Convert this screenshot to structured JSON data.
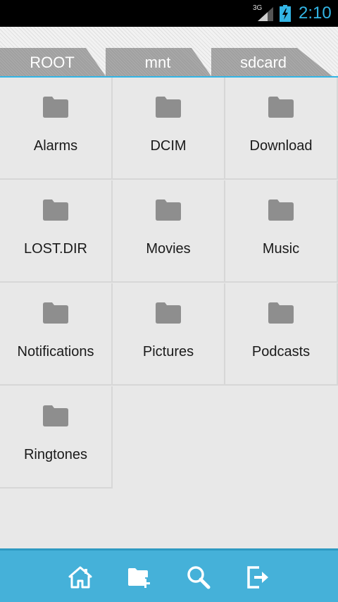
{
  "status_bar": {
    "network": "3G",
    "time": "2:10",
    "colors": {
      "background": "#000000",
      "clock": "#33b5e5"
    },
    "icons": [
      "signal-icon",
      "battery-charging-icon"
    ]
  },
  "breadcrumbs": [
    {
      "label": "ROOT"
    },
    {
      "label": "mnt"
    },
    {
      "label": "sdcard"
    }
  ],
  "folders": [
    {
      "name": "Alarms"
    },
    {
      "name": "DCIM"
    },
    {
      "name": "Download"
    },
    {
      "name": "LOST.DIR"
    },
    {
      "name": "Movies"
    },
    {
      "name": "Music"
    },
    {
      "name": "Notifications"
    },
    {
      "name": "Pictures"
    },
    {
      "name": "Podcasts"
    },
    {
      "name": "Ringtones"
    }
  ],
  "toolbar": {
    "items": [
      {
        "icon": "home-icon"
      },
      {
        "icon": "new-folder-icon"
      },
      {
        "icon": "search-icon"
      },
      {
        "icon": "exit-icon"
      }
    ],
    "colors": {
      "background": "#45b1d9",
      "icon": "#ffffff"
    }
  },
  "colors": {
    "accent": "#33b5e5",
    "folder_icon": "#8e8e8e",
    "background": "#e8e8e8"
  }
}
